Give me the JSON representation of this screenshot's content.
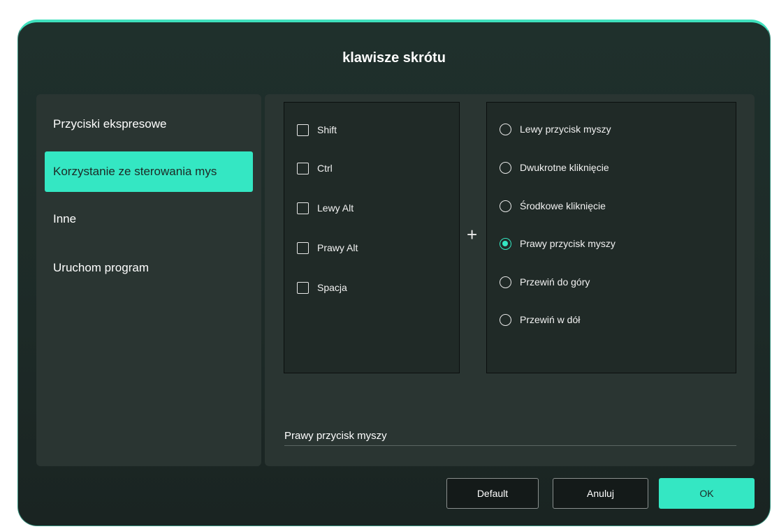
{
  "dialog": {
    "title": "klawisze skrótu"
  },
  "sidebar": {
    "items": [
      {
        "label": "Przyciski ekspresowe"
      },
      {
        "label": "Korzystanie ze sterowania mys"
      },
      {
        "label": "Inne"
      },
      {
        "label": "Uruchom program"
      }
    ],
    "active_index": 1
  },
  "modifiers": [
    {
      "label": "Shift",
      "checked": false
    },
    {
      "label": "Ctrl",
      "checked": false
    },
    {
      "label": "Lewy Alt",
      "checked": false
    },
    {
      "label": "Prawy Alt",
      "checked": false
    },
    {
      "label": "Spacja",
      "checked": false
    }
  ],
  "plus_symbol": "+",
  "mouse_actions": [
    {
      "label": "Lewy przycisk myszy",
      "selected": false
    },
    {
      "label": "Dwukrotne kliknięcie",
      "selected": false
    },
    {
      "label": "Środkowe kliknięcie",
      "selected": false
    },
    {
      "label": "Prawy przycisk myszy",
      "selected": true
    },
    {
      "label": "Przewiń do góry",
      "selected": false
    },
    {
      "label": "Przewiń w dół",
      "selected": false
    }
  ],
  "result_text": "Prawy przycisk myszy",
  "buttons": {
    "default_label": "Default",
    "cancel_label": "Anuluj",
    "ok_label": "OK"
  },
  "colors": {
    "accent": "#34e7c3",
    "panel": "#2a3532",
    "background": "#1f2d29"
  }
}
